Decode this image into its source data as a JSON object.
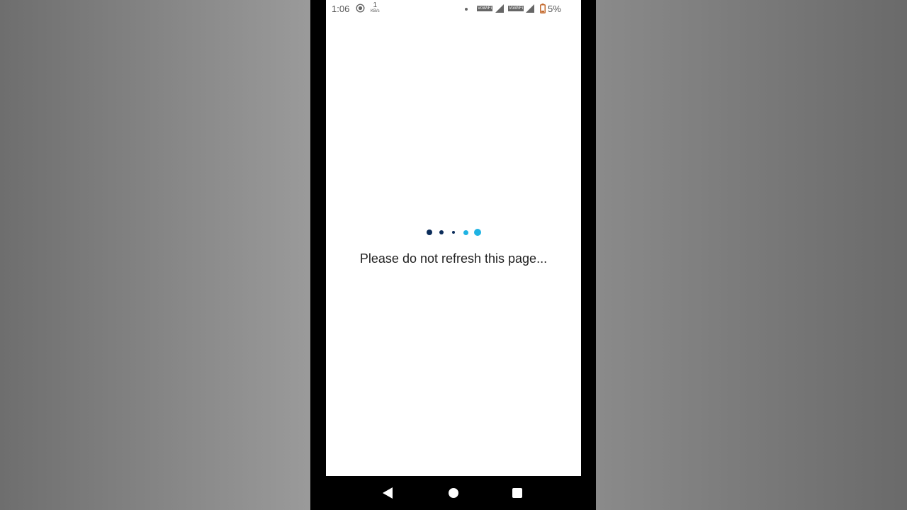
{
  "status_bar": {
    "time": "1:06",
    "network_speed": "1",
    "network_speed_unit": "KB/s",
    "volte_label": "VoWiFi",
    "battery_percent": "5%",
    "icons": [
      "screen-record-icon",
      "notification-dot-icon",
      "volte-icon",
      "signal-icon",
      "battery-icon"
    ]
  },
  "main": {
    "loader_colors": [
      "#0b2c5a",
      "#0b2c5a",
      "#0b2c5a",
      "#1fb3e3",
      "#1fb3e3"
    ],
    "message": "Please do not refresh this page..."
  },
  "nav_bar": {
    "icons": [
      "back-icon",
      "home-icon",
      "recents-icon"
    ]
  }
}
